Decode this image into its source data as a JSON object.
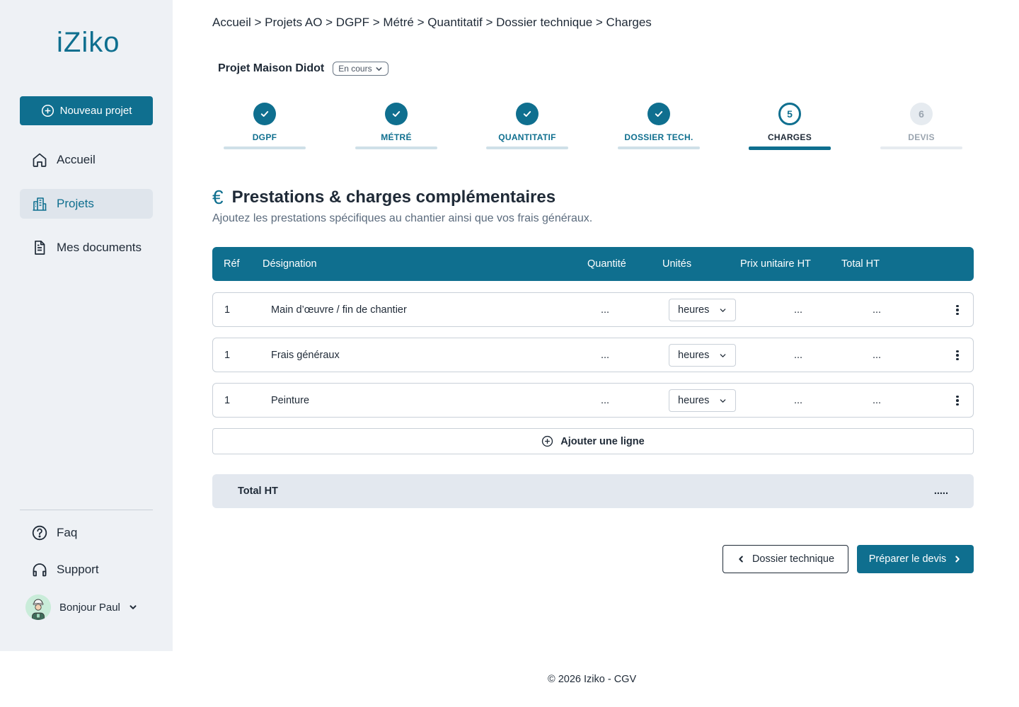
{
  "app": {
    "logo_text": "iZiko"
  },
  "sidebar": {
    "new_project_label": "Nouveau projet",
    "items": [
      {
        "label": "Accueil",
        "icon": "home-icon"
      },
      {
        "label": "Projets",
        "icon": "buildings-icon",
        "active": true
      },
      {
        "label": "Mes documents",
        "icon": "document-icon"
      }
    ],
    "bottom_items": [
      {
        "label": "Faq",
        "icon": "question-icon"
      },
      {
        "label": "Support",
        "icon": "headphones-icon"
      }
    ],
    "user_greeting": "Bonjour Paul"
  },
  "breadcrumb": "Accueil > Projets AO > DGPF > Métré > Quantitatif > Dossier technique > Charges",
  "project": {
    "title": "Projet Maison Didot",
    "status": "En cours"
  },
  "stepper": {
    "steps": [
      {
        "label": "DGPF",
        "state": "done"
      },
      {
        "label": "MÉTRÉ",
        "state": "done"
      },
      {
        "label": "QUANTITATIF",
        "state": "done"
      },
      {
        "label": "DOSSIER TECH.",
        "state": "done"
      },
      {
        "label": "CHARGES",
        "state": "current",
        "number": "5"
      },
      {
        "label": "DEVIS",
        "state": "todo",
        "number": "6"
      }
    ]
  },
  "section": {
    "title": "Prestations & charges complémentaires",
    "subtitle": "Ajoutez les prestations spécifiques au chantier ainsi que vos frais généraux.",
    "icon": "euro-icon"
  },
  "table": {
    "headers": [
      "Réf",
      "Désignation",
      "Quantité",
      "Unités",
      "Prix unitaire HT",
      "Total HT"
    ],
    "rows": [
      {
        "ref": "1",
        "designation": "Main d’œuvre / fin de chantier",
        "quantite": "...",
        "unite": "heures",
        "prix": "...",
        "total": "..."
      },
      {
        "ref": "1",
        "designation": "Frais généraux",
        "quantite": "...",
        "unite": "heures",
        "prix": "...",
        "total": "..."
      },
      {
        "ref": "1",
        "designation": "Peinture",
        "quantite": "...",
        "unite": "heures",
        "prix": "...",
        "total": "..."
      }
    ],
    "add_line_label": "Ajouter une ligne"
  },
  "total": {
    "label": "Total HT",
    "value": "....."
  },
  "actions": {
    "back_label": "Dossier technique",
    "next_label": "Préparer le devis"
  },
  "footer": {
    "text": "© 2026 Iziko - CGV"
  },
  "colors": {
    "brand": "#0f6f8f",
    "sidebar_bg": "#eef1f5",
    "total_bg": "#e3e8ef"
  }
}
